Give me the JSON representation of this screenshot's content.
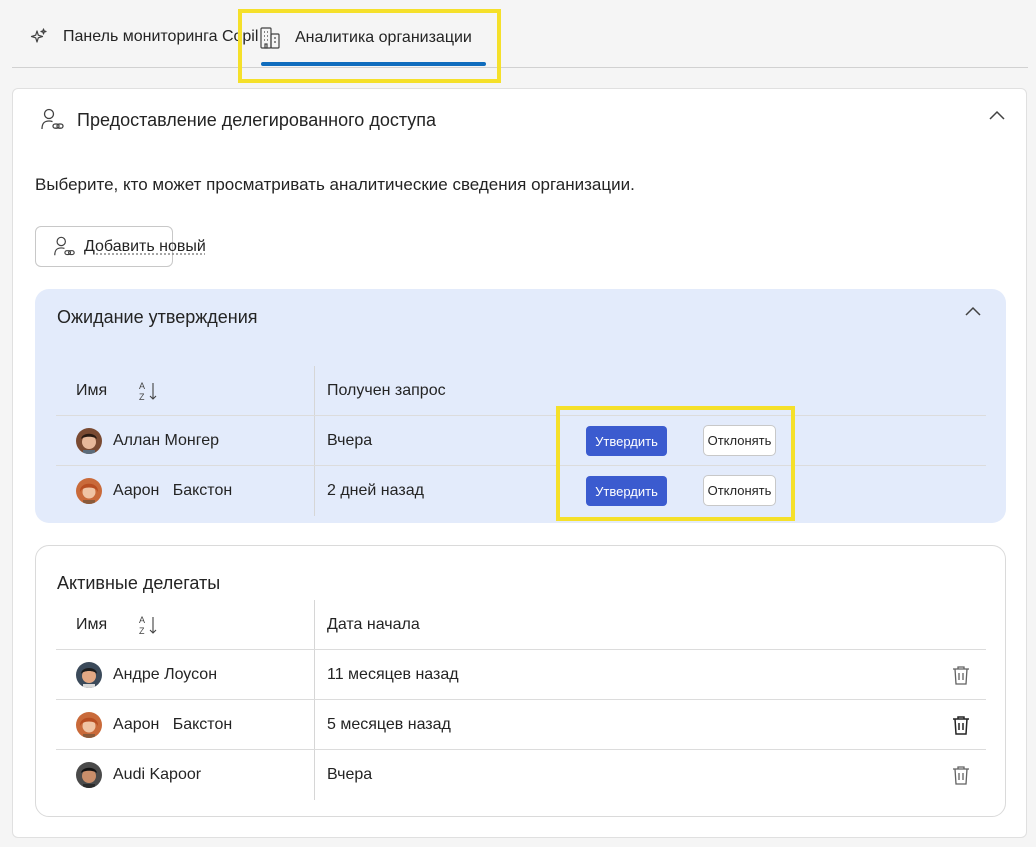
{
  "tabs": {
    "copilot_label": "Панель мониторинга Copilot",
    "org_label": "Аналитика организации"
  },
  "section": {
    "title": "Предоставление делегированного доступа",
    "description": "Выберите, кто может просматривать аналитические сведения организации.",
    "add_new_label": "Добавить новый"
  },
  "pending": {
    "title": "Ожидание утверждения",
    "col_name": "Имя",
    "col_date": "Получен запрос",
    "approve_label": "Утвердить",
    "reject_label": "Отклонять",
    "rows": [
      {
        "name": "Аллан Монгер",
        "date": "Вчера"
      },
      {
        "name": "Аарон   Бакстон",
        "date": "2 дней назад"
      }
    ]
  },
  "active": {
    "title": "Активные делегаты",
    "col_name": "Имя",
    "col_date": "Дата начала",
    "rows": [
      {
        "name": "Андре Лоусон",
        "date": "11 месяцев назад"
      },
      {
        "name": "Аарон   Бакстон",
        "date": "5 месяцев назад"
      },
      {
        "name": "Audi Kapoor",
        "date": "Вчера"
      }
    ]
  },
  "colors": {
    "accent": "#0f6cbd",
    "approve_button": "#3b5bcf",
    "pending_bg": "#e3ebfb",
    "highlight": "#f5e02a"
  },
  "icons": [
    "sparkle-icon",
    "building-icon",
    "person-link-icon",
    "chevron-up-icon",
    "sort-az-icon",
    "trash-icon",
    "avatar"
  ]
}
